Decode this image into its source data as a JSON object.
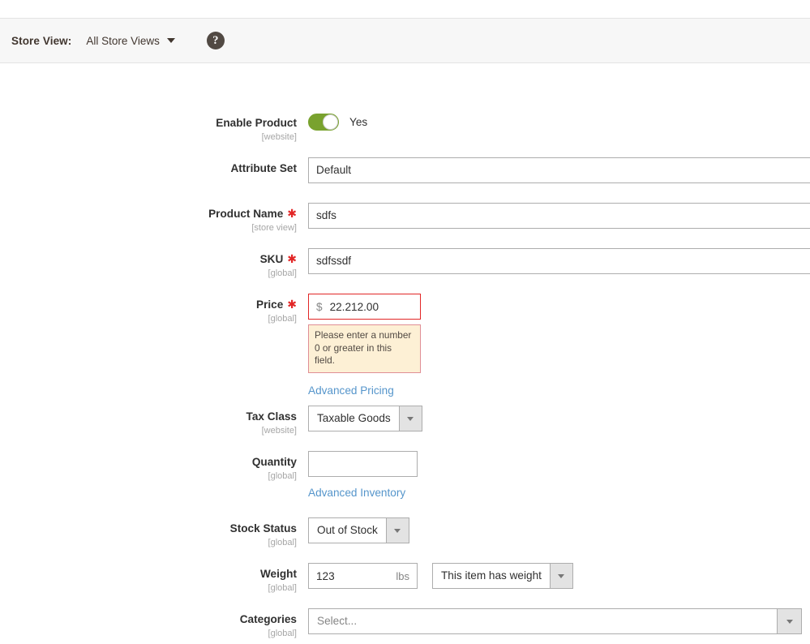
{
  "header": {
    "store_view_label": "Store View:",
    "store_view_value": "All Store Views",
    "help_icon": "question-mark-icon",
    "help_glyph": "?"
  },
  "form": {
    "fields": [
      {
        "key": "enable_product",
        "label": "Enable Product",
        "scope": "[website]",
        "required": false,
        "toggle_state": "Yes",
        "toggle_color": "#79a22e"
      },
      {
        "key": "attribute_set",
        "label": "Attribute Set",
        "scope": "",
        "required": false,
        "value": "Default"
      },
      {
        "key": "product_name",
        "label": "Product Name",
        "scope": "[store view]",
        "required": true,
        "value": "sdfs"
      },
      {
        "key": "sku",
        "label": "SKU",
        "scope": "[global]",
        "required": true,
        "value": "sdfssdf"
      },
      {
        "key": "price",
        "label": "Price",
        "scope": "[global]",
        "required": true,
        "currency_symbol": "$",
        "value": "22.212.00",
        "error_message": "Please enter a number 0 or greater in this field.",
        "error_border_color": "#e22626",
        "error_bg_color": "#fdf0d5",
        "link_label": "Advanced Pricing"
      },
      {
        "key": "tax_class",
        "label": "Tax Class",
        "scope": "[website]",
        "required": false,
        "value": "Taxable Goods"
      },
      {
        "key": "quantity",
        "label": "Quantity",
        "scope": "[global]",
        "required": false,
        "value": "",
        "link_label": "Advanced Inventory"
      },
      {
        "key": "stock_status",
        "label": "Stock Status",
        "scope": "[global]",
        "required": false,
        "value": "Out of Stock"
      },
      {
        "key": "weight",
        "label": "Weight",
        "scope": "[global]",
        "required": false,
        "value": "123",
        "unit": "lbs",
        "has_weight_value": "This item has weight"
      },
      {
        "key": "categories",
        "label": "Categories",
        "scope": "[global]",
        "required": false,
        "placeholder": "Select..."
      }
    ]
  },
  "colors": {
    "link": "#5595cb",
    "required_star": "#e22626",
    "toggle_on": "#79a22e",
    "header_bg": "#f7f7f7",
    "help_icon_bg": "#514943"
  }
}
